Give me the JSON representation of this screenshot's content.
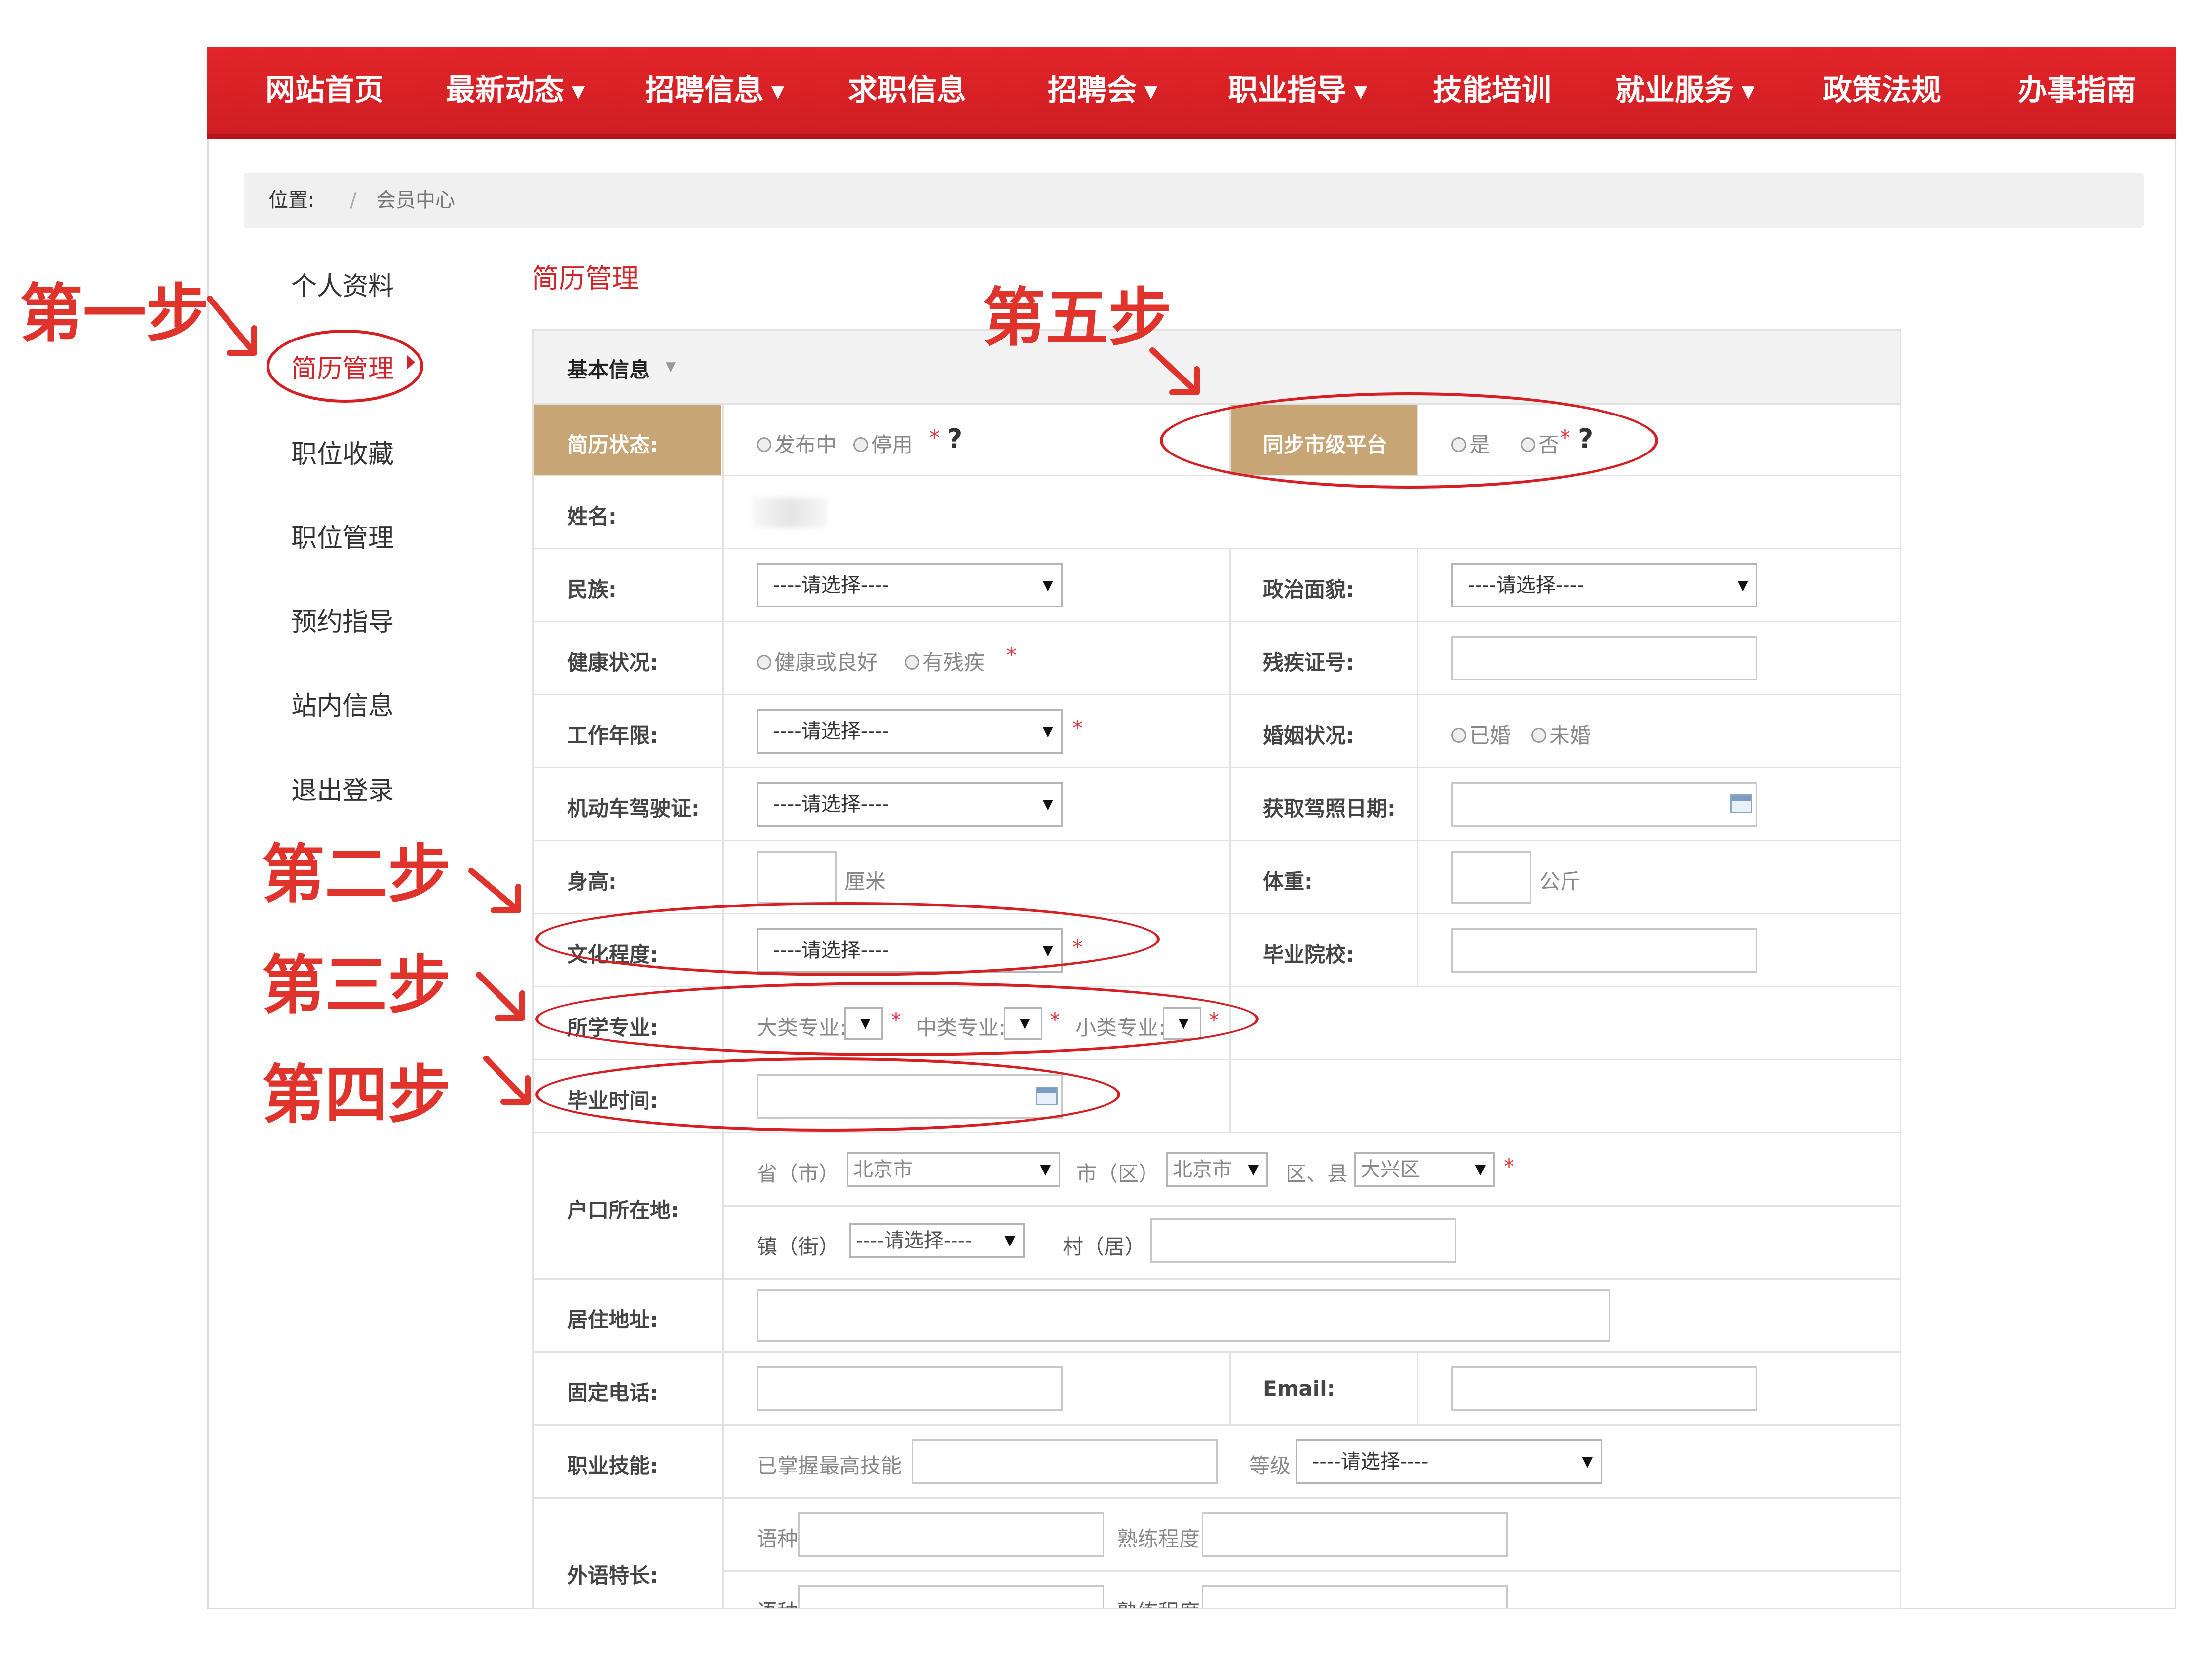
{
  "nav": [
    {
      "label": "网站首页",
      "caret": false
    },
    {
      "label": "最新动态",
      "caret": true
    },
    {
      "label": "招聘信息",
      "caret": true
    },
    {
      "label": "求职信息",
      "caret": false
    },
    {
      "label": "招聘会",
      "caret": true
    },
    {
      "label": "职业指导",
      "caret": true
    },
    {
      "label": "技能培训",
      "caret": false
    },
    {
      "label": "就业服务",
      "caret": true
    },
    {
      "label": "政策法规",
      "caret": false
    },
    {
      "label": "办事指南",
      "caret": false
    }
  ],
  "breadcrumb": {
    "position_label": "位置:",
    "separator": "/",
    "current": "会员中心"
  },
  "sidebar": {
    "items": [
      "个人资料",
      "简历管理",
      "职位收藏",
      "职位管理",
      "预约指导",
      "站内信息",
      "退出登录"
    ],
    "active": "简历管理"
  },
  "page_title": "简历管理",
  "form": {
    "section_header": "基本信息",
    "resume_status": {
      "label": "简历状态:",
      "options": [
        "发布中",
        "停用"
      ]
    },
    "sync_platform": {
      "label": "同步市级平台",
      "options": [
        "是",
        "否"
      ]
    },
    "name": {
      "label": "姓名:"
    },
    "ethnicity": {
      "label": "民族:",
      "value": "----请选择----"
    },
    "political": {
      "label": "政治面貌:",
      "value": "----请选择----"
    },
    "health": {
      "label": "健康状况:",
      "options": [
        "健康或良好",
        "有残疾"
      ]
    },
    "disability_no": {
      "label": "残疾证号:"
    },
    "work_years": {
      "label": "工作年限:",
      "value": "----请选择----"
    },
    "marital": {
      "label": "婚姻状况:",
      "options": [
        "已婚",
        "未婚"
      ]
    },
    "license": {
      "label": "机动车驾驶证:",
      "value": "----请选择----"
    },
    "license_date": {
      "label": "获取驾照日期:"
    },
    "height": {
      "label": "身高:",
      "unit": "厘米"
    },
    "weight": {
      "label": "体重:",
      "unit": "公斤"
    },
    "education": {
      "label": "文化程度:",
      "value": "----请选择----"
    },
    "school": {
      "label": "毕业院校:"
    },
    "major": {
      "label": "所学专业:",
      "major_big": "大类专业:",
      "major_mid": "中类专业:",
      "major_small": "小类专业:"
    },
    "grad_time": {
      "label": "毕业时间:"
    },
    "hukou": {
      "label": "户口所在地:",
      "province_label": "省（市）",
      "province": "北京市",
      "city_label": "市（区）",
      "city": "北京市",
      "county_label": "区、县",
      "county": "大兴区",
      "town_label": "镇（街）",
      "town": "----请选择----",
      "village_label": "村（居）"
    },
    "address": {
      "label": "居住地址:"
    },
    "phone": {
      "label": "固定电话:"
    },
    "email": {
      "label": "Email:"
    },
    "skill": {
      "label": "职业技能:",
      "mastered": "已掌握最高技能",
      "level_label": "等级",
      "level": "----请选择----"
    },
    "language": {
      "label": "外语特长:",
      "lang": "语种",
      "proficiency": "熟练程度"
    },
    "required_mark": "*",
    "help_mark": "?"
  },
  "annotations": {
    "step1": "第一步",
    "step2": "第二步",
    "step3": "第三步",
    "step4": "第四步",
    "step5": "第五步"
  },
  "colors": {
    "nav_red": "#d0262b",
    "accent_red": "#e0332b",
    "label_gold": "#c8a574"
  }
}
